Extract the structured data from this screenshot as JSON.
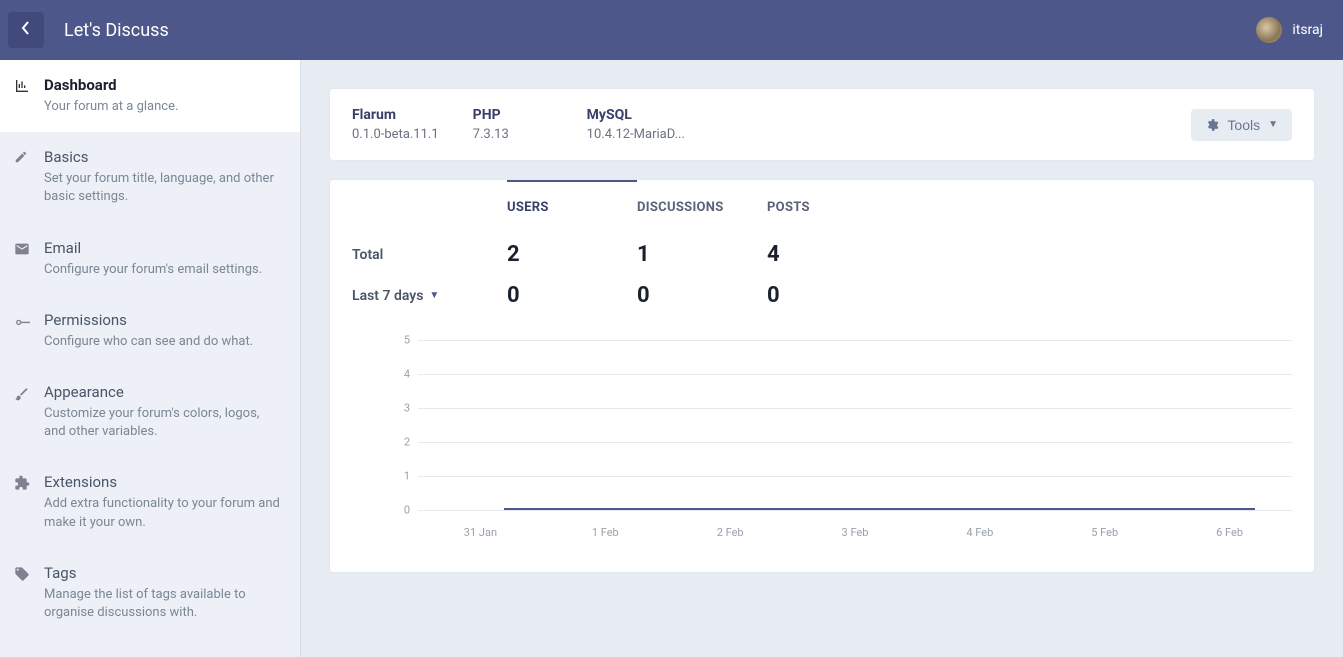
{
  "header": {
    "app_title": "Let's Discuss",
    "username": "itsraj"
  },
  "sidebar": {
    "items": [
      {
        "icon": "chart-icon",
        "title": "Dashboard",
        "desc": "Your forum at a glance.",
        "active": true
      },
      {
        "icon": "pencil-icon",
        "title": "Basics",
        "desc": "Set your forum title, language, and other basic settings."
      },
      {
        "icon": "mail-icon",
        "title": "Email",
        "desc": "Configure your forum's email settings."
      },
      {
        "icon": "key-icon",
        "title": "Permissions",
        "desc": "Configure who can see and do what."
      },
      {
        "icon": "brush-icon",
        "title": "Appearance",
        "desc": "Customize your forum's colors, logos, and other variables."
      },
      {
        "icon": "puzzle-icon",
        "title": "Extensions",
        "desc": "Add extra functionality to your forum and make it your own."
      },
      {
        "icon": "tags-icon",
        "title": "Tags",
        "desc": "Manage the list of tags available to organise discussions with."
      }
    ]
  },
  "status": {
    "cols": [
      {
        "label": "Flarum",
        "value": "0.1.0-beta.11.1"
      },
      {
        "label": "PHP",
        "value": "7.3.13"
      },
      {
        "label": "MySQL",
        "value": "10.4.12-MariaD..."
      }
    ],
    "tools_label": "Tools"
  },
  "stats": {
    "columns": [
      "USERS",
      "DISCUSSIONS",
      "POSTS"
    ],
    "active_column": 0,
    "rows": [
      {
        "label": "Total",
        "dropdown": false,
        "values": [
          "2",
          "1",
          "4"
        ]
      },
      {
        "label": "Last 7 days",
        "dropdown": true,
        "values": [
          "0",
          "0",
          "0"
        ]
      }
    ]
  },
  "chart_data": {
    "type": "line",
    "title": "",
    "xlabel": "",
    "ylabel": "",
    "ylim": [
      0,
      5
    ],
    "y_ticks": [
      0,
      1,
      2,
      3,
      4,
      5
    ],
    "x_categories": [
      "31 Jan",
      "1 Feb",
      "2 Feb",
      "3 Feb",
      "4 Feb",
      "5 Feb",
      "6 Feb"
    ],
    "series": [
      {
        "name": "Users",
        "values": [
          0,
          0,
          0,
          0,
          0,
          0,
          0
        ]
      }
    ],
    "colors": {
      "series": "#4d578a",
      "grid": "#e7e9ee"
    }
  }
}
